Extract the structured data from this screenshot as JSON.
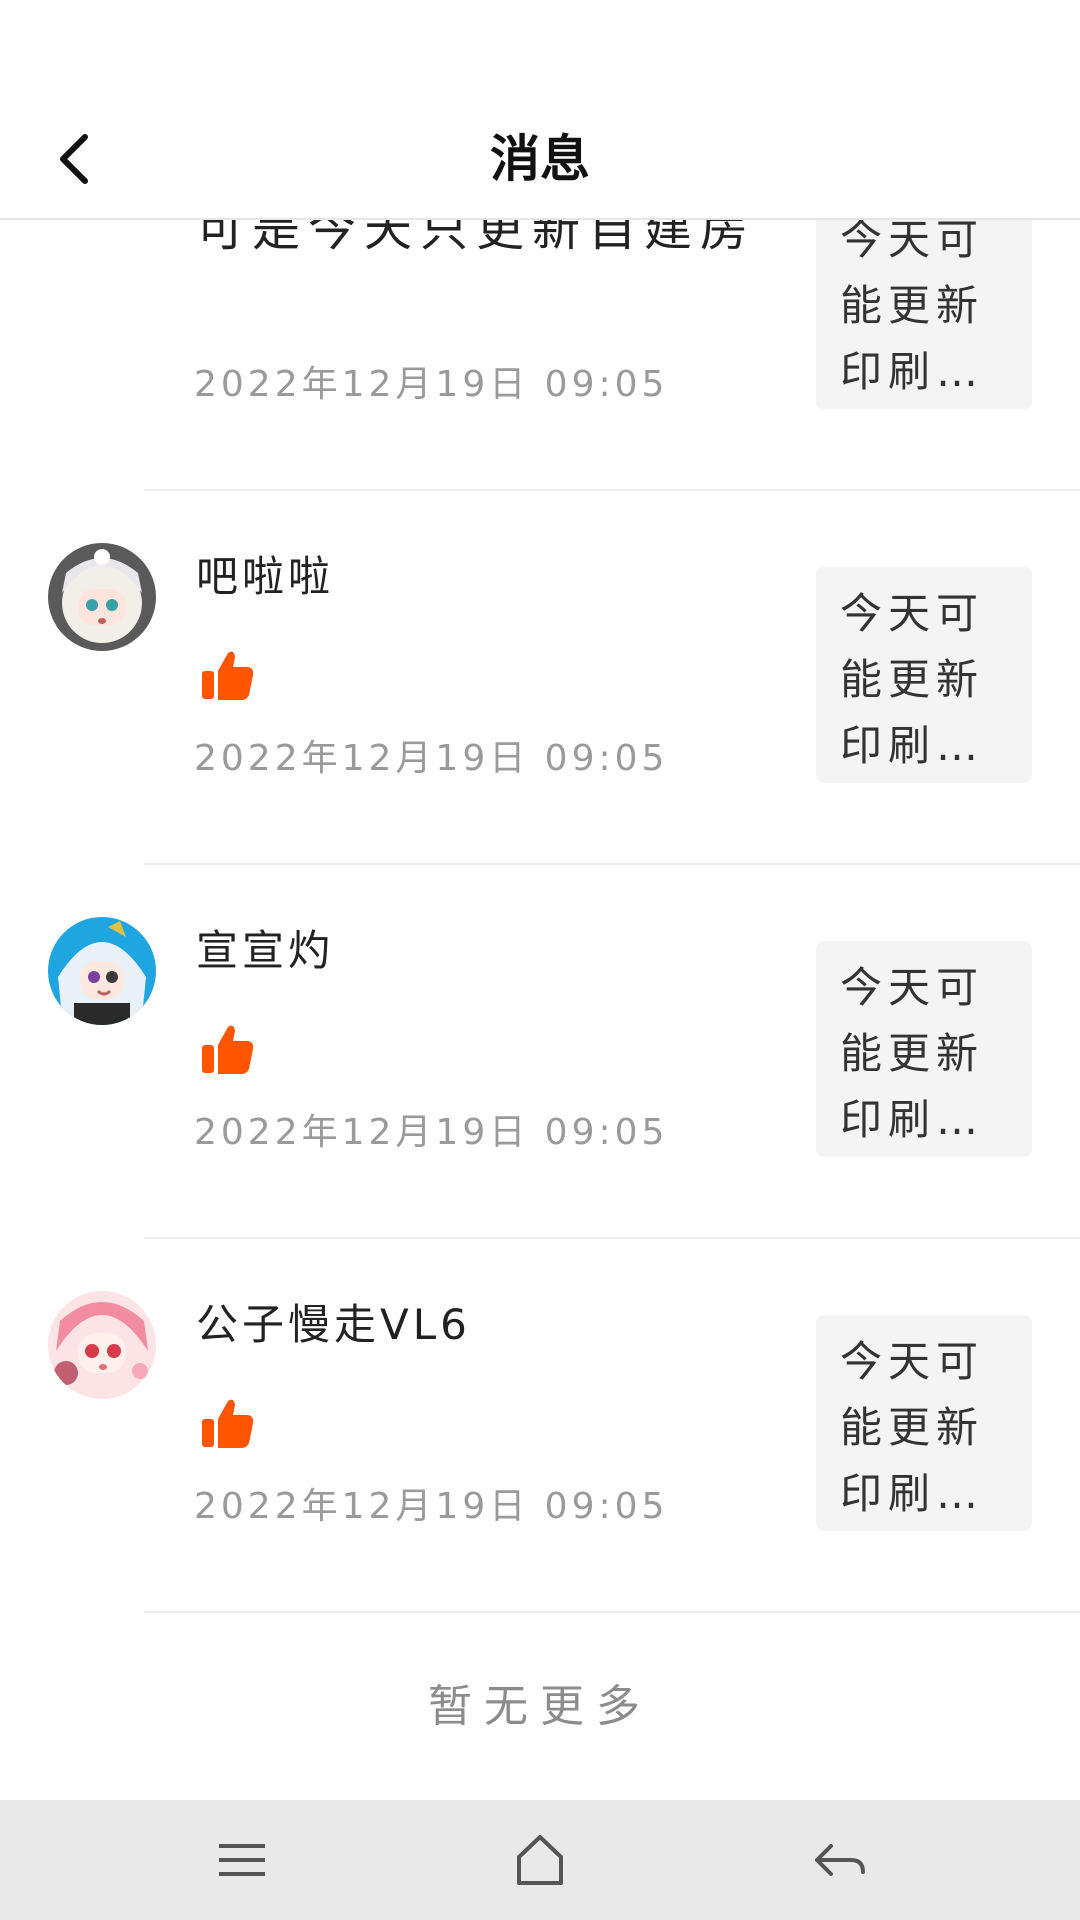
{
  "header": {
    "title": "消息"
  },
  "items": [
    {
      "content": "可是今天只更新自建房",
      "time": "2022年12月19日 09:05",
      "preview": "今天可能更新印刷…"
    },
    {
      "name": "吧啦啦",
      "time": "2022年12月19日 09:05",
      "preview": "今天可能更新印刷…",
      "icon": "thumbs-up-icon"
    },
    {
      "name": "宣宣灼",
      "time": "2022年12月19日 09:05",
      "preview": "今天可能更新印刷…",
      "icon": "thumbs-up-icon"
    },
    {
      "name": "公子慢走VL6",
      "time": "2022年12月19日 09:05",
      "preview": "今天可能更新印刷…",
      "icon": "thumbs-up-icon"
    }
  ],
  "footer": {
    "no_more": "暂无更多"
  },
  "colors": {
    "accent": "#ff5500",
    "divider": "#ececec",
    "nav_bg": "#e9e9e9"
  },
  "nav": {
    "icons": [
      "menu-icon",
      "home-icon",
      "back-arrow-icon"
    ]
  }
}
